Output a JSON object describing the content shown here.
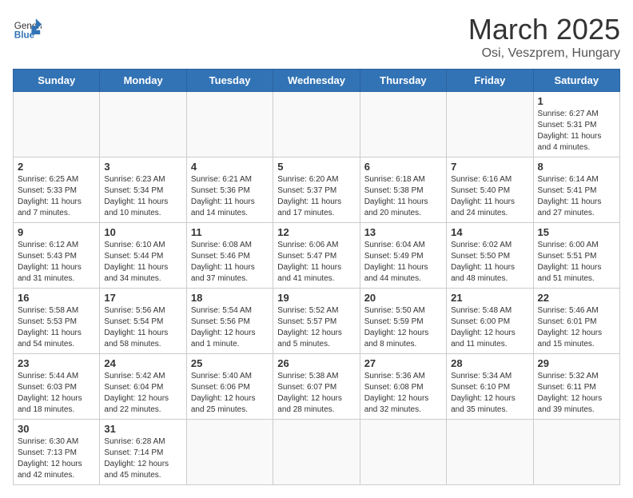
{
  "header": {
    "logo_general": "General",
    "logo_blue": "Blue",
    "month_year": "March 2025",
    "location": "Osi, Veszprem, Hungary"
  },
  "weekdays": [
    "Sunday",
    "Monday",
    "Tuesday",
    "Wednesday",
    "Thursday",
    "Friday",
    "Saturday"
  ],
  "rows": [
    [
      {
        "day": "",
        "info": ""
      },
      {
        "day": "",
        "info": ""
      },
      {
        "day": "",
        "info": ""
      },
      {
        "day": "",
        "info": ""
      },
      {
        "day": "",
        "info": ""
      },
      {
        "day": "",
        "info": ""
      },
      {
        "day": "1",
        "info": "Sunrise: 6:27 AM\nSunset: 5:31 PM\nDaylight: 11 hours and 4 minutes."
      }
    ],
    [
      {
        "day": "2",
        "info": "Sunrise: 6:25 AM\nSunset: 5:33 PM\nDaylight: 11 hours and 7 minutes."
      },
      {
        "day": "3",
        "info": "Sunrise: 6:23 AM\nSunset: 5:34 PM\nDaylight: 11 hours and 10 minutes."
      },
      {
        "day": "4",
        "info": "Sunrise: 6:21 AM\nSunset: 5:36 PM\nDaylight: 11 hours and 14 minutes."
      },
      {
        "day": "5",
        "info": "Sunrise: 6:20 AM\nSunset: 5:37 PM\nDaylight: 11 hours and 17 minutes."
      },
      {
        "day": "6",
        "info": "Sunrise: 6:18 AM\nSunset: 5:38 PM\nDaylight: 11 hours and 20 minutes."
      },
      {
        "day": "7",
        "info": "Sunrise: 6:16 AM\nSunset: 5:40 PM\nDaylight: 11 hours and 24 minutes."
      },
      {
        "day": "8",
        "info": "Sunrise: 6:14 AM\nSunset: 5:41 PM\nDaylight: 11 hours and 27 minutes."
      }
    ],
    [
      {
        "day": "9",
        "info": "Sunrise: 6:12 AM\nSunset: 5:43 PM\nDaylight: 11 hours and 31 minutes."
      },
      {
        "day": "10",
        "info": "Sunrise: 6:10 AM\nSunset: 5:44 PM\nDaylight: 11 hours and 34 minutes."
      },
      {
        "day": "11",
        "info": "Sunrise: 6:08 AM\nSunset: 5:46 PM\nDaylight: 11 hours and 37 minutes."
      },
      {
        "day": "12",
        "info": "Sunrise: 6:06 AM\nSunset: 5:47 PM\nDaylight: 11 hours and 41 minutes."
      },
      {
        "day": "13",
        "info": "Sunrise: 6:04 AM\nSunset: 5:49 PM\nDaylight: 11 hours and 44 minutes."
      },
      {
        "day": "14",
        "info": "Sunrise: 6:02 AM\nSunset: 5:50 PM\nDaylight: 11 hours and 48 minutes."
      },
      {
        "day": "15",
        "info": "Sunrise: 6:00 AM\nSunset: 5:51 PM\nDaylight: 11 hours and 51 minutes."
      }
    ],
    [
      {
        "day": "16",
        "info": "Sunrise: 5:58 AM\nSunset: 5:53 PM\nDaylight: 11 hours and 54 minutes."
      },
      {
        "day": "17",
        "info": "Sunrise: 5:56 AM\nSunset: 5:54 PM\nDaylight: 11 hours and 58 minutes."
      },
      {
        "day": "18",
        "info": "Sunrise: 5:54 AM\nSunset: 5:56 PM\nDaylight: 12 hours and 1 minute."
      },
      {
        "day": "19",
        "info": "Sunrise: 5:52 AM\nSunset: 5:57 PM\nDaylight: 12 hours and 5 minutes."
      },
      {
        "day": "20",
        "info": "Sunrise: 5:50 AM\nSunset: 5:59 PM\nDaylight: 12 hours and 8 minutes."
      },
      {
        "day": "21",
        "info": "Sunrise: 5:48 AM\nSunset: 6:00 PM\nDaylight: 12 hours and 11 minutes."
      },
      {
        "day": "22",
        "info": "Sunrise: 5:46 AM\nSunset: 6:01 PM\nDaylight: 12 hours and 15 minutes."
      }
    ],
    [
      {
        "day": "23",
        "info": "Sunrise: 5:44 AM\nSunset: 6:03 PM\nDaylight: 12 hours and 18 minutes."
      },
      {
        "day": "24",
        "info": "Sunrise: 5:42 AM\nSunset: 6:04 PM\nDaylight: 12 hours and 22 minutes."
      },
      {
        "day": "25",
        "info": "Sunrise: 5:40 AM\nSunset: 6:06 PM\nDaylight: 12 hours and 25 minutes."
      },
      {
        "day": "26",
        "info": "Sunrise: 5:38 AM\nSunset: 6:07 PM\nDaylight: 12 hours and 28 minutes."
      },
      {
        "day": "27",
        "info": "Sunrise: 5:36 AM\nSunset: 6:08 PM\nDaylight: 12 hours and 32 minutes."
      },
      {
        "day": "28",
        "info": "Sunrise: 5:34 AM\nSunset: 6:10 PM\nDaylight: 12 hours and 35 minutes."
      },
      {
        "day": "29",
        "info": "Sunrise: 5:32 AM\nSunset: 6:11 PM\nDaylight: 12 hours and 39 minutes."
      }
    ],
    [
      {
        "day": "30",
        "info": "Sunrise: 6:30 AM\nSunset: 7:13 PM\nDaylight: 12 hours and 42 minutes."
      },
      {
        "day": "31",
        "info": "Sunrise: 6:28 AM\nSunset: 7:14 PM\nDaylight: 12 hours and 45 minutes."
      },
      {
        "day": "",
        "info": ""
      },
      {
        "day": "",
        "info": ""
      },
      {
        "day": "",
        "info": ""
      },
      {
        "day": "",
        "info": ""
      },
      {
        "day": "",
        "info": ""
      }
    ]
  ]
}
